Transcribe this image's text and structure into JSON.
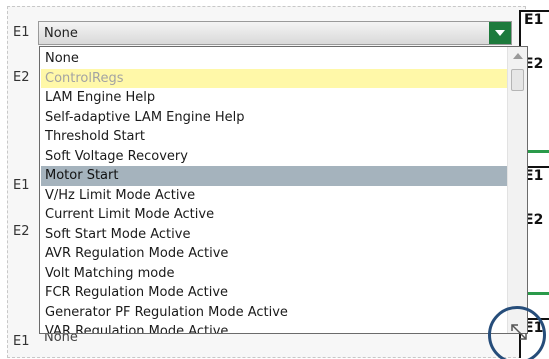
{
  "rows": {
    "labels": [
      "E1",
      "E2",
      "E1",
      "E2",
      "E1"
    ],
    "combo_value": "None",
    "bottom_value": "None"
  },
  "right_labels": [
    "E1",
    "E2",
    "E1",
    "E2",
    "E1"
  ],
  "dropdown": {
    "items": [
      {
        "label": "None",
        "state": "normal"
      },
      {
        "label": "ControlRegs",
        "state": "disabled"
      },
      {
        "label": "LAM Engine Help",
        "state": "normal"
      },
      {
        "label": "Self-adaptive LAM Engine Help",
        "state": "normal"
      },
      {
        "label": "Threshold Start",
        "state": "normal"
      },
      {
        "label": "Soft Voltage Recovery",
        "state": "normal"
      },
      {
        "label": "Motor Start",
        "state": "selected"
      },
      {
        "label": "V/Hz Limit Mode Active",
        "state": "normal"
      },
      {
        "label": "Current Limit Mode Active",
        "state": "normal"
      },
      {
        "label": "Soft Start Mode Active",
        "state": "normal"
      },
      {
        "label": "AVR Regulation Mode Active",
        "state": "normal"
      },
      {
        "label": "Volt Matching mode",
        "state": "normal"
      },
      {
        "label": "FCR Regulation Mode Active",
        "state": "normal"
      },
      {
        "label": "Generator PF Regulation Mode Active",
        "state": "normal"
      },
      {
        "label": "VAR Regulation Mode Active",
        "state": "normal"
      }
    ]
  },
  "colors": {
    "accent_green": "#1d7a3c",
    "selected_bg": "#a5b3bd",
    "disabled_bg": "#fff8a8",
    "highlight_ring": "#264d7a"
  }
}
